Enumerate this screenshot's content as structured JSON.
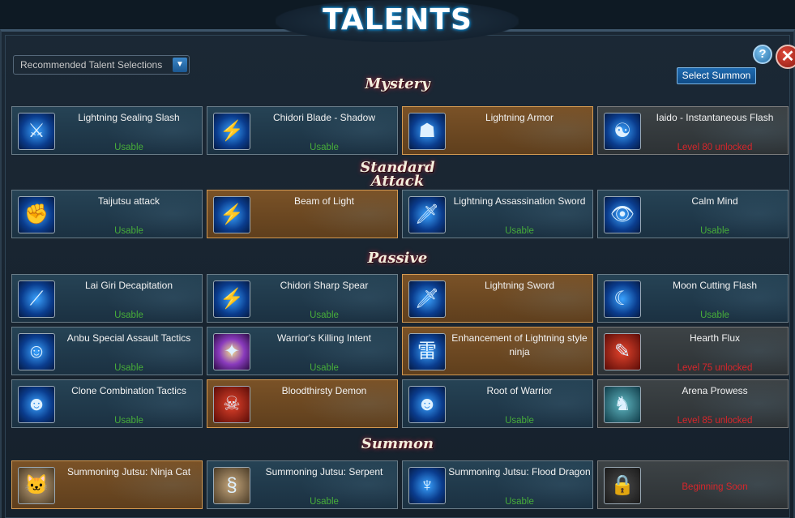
{
  "header": {
    "title": "TALENTS"
  },
  "controls": {
    "dropdown_value": "Recommended Talent Selections",
    "select_summon": "Select Summon",
    "help": "?",
    "close": "✕"
  },
  "sections": [
    {
      "title": "Mystery",
      "cards": [
        {
          "name": "Lightning Sealing Slash",
          "status": "Usable",
          "style": "blue",
          "icon": "blade-icon",
          "status_color": "green"
        },
        {
          "name": "Chidori Blade - Shadow",
          "status": "Usable",
          "style": "blue",
          "icon": "lightning-blade-icon",
          "status_color": "green"
        },
        {
          "name": "Lightning Armor",
          "status": "",
          "style": "gold",
          "icon": "armor-icon",
          "status_color": "green"
        },
        {
          "name": "Iaido - Instantaneous Flash",
          "status": "Level 80 unlocked",
          "style": "grey",
          "icon": "ninja-icon",
          "status_color": "red"
        }
      ]
    },
    {
      "title": "Standard Attack",
      "cards": [
        {
          "name": "Taijutsu attack",
          "status": "Usable",
          "style": "blue",
          "icon": "fist-icon",
          "status_color": "green"
        },
        {
          "name": "Beam of Light",
          "status": "",
          "style": "gold",
          "icon": "beam-icon",
          "status_color": "green"
        },
        {
          "name": "Lightning Assassination Sword",
          "status": "Usable",
          "style": "blue",
          "icon": "sword-icon",
          "status_color": "green"
        },
        {
          "name": "Calm Mind",
          "status": "Usable",
          "style": "blue",
          "icon": "eye-icon",
          "status_color": "green"
        }
      ]
    },
    {
      "title": "Passive",
      "cards": [
        {
          "name": "Lai Giri Decapitation",
          "status": "Usable",
          "style": "blue",
          "icon": "slash-icon",
          "status_color": "green"
        },
        {
          "name": "Chidori Sharp Spear",
          "status": "Usable",
          "style": "blue",
          "icon": "spear-icon",
          "status_color": "green"
        },
        {
          "name": "Lightning Sword",
          "status": "",
          "style": "gold",
          "icon": "sword-icon",
          "status_color": "green"
        },
        {
          "name": "Moon Cutting Flash",
          "status": "Usable",
          "style": "blue",
          "icon": "moon-icon",
          "status_color": "green"
        },
        {
          "name": "Anbu Special Assault Tactics",
          "status": "Usable",
          "style": "blue",
          "icon": "figure-icon",
          "status_color": "green"
        },
        {
          "name": "Warrior's Killing Intent",
          "status": "Usable",
          "style": "blue",
          "icon": "strike-icon",
          "status_color": "green"
        },
        {
          "name": "Enhancement of Lightning style ninja",
          "status": "",
          "style": "gold",
          "icon": "kanji-icon",
          "status_color": "green"
        },
        {
          "name": "Hearth Flux",
          "status": "Level 75 unlocked",
          "style": "grey",
          "icon": "scroll-icon",
          "status_color": "red"
        },
        {
          "name": "Clone Combination Tactics",
          "status": "Usable",
          "style": "blue",
          "icon": "clones-icon",
          "status_color": "green"
        },
        {
          "name": "Bloodthirsty Demon",
          "status": "",
          "style": "gold",
          "icon": "demon-icon",
          "status_color": "green"
        },
        {
          "name": "Root of Warrior",
          "status": "Usable",
          "style": "blue",
          "icon": "head-icon",
          "status_color": "green"
        },
        {
          "name": "Arena Prowess",
          "status": "Level 85 unlocked",
          "style": "grey",
          "icon": "warrior-icon",
          "status_color": "red"
        }
      ]
    },
    {
      "title": "Summon",
      "cards": [
        {
          "name": "Summoning Jutsu: Ninja Cat",
          "status": "",
          "style": "gold",
          "icon": "cat-icon",
          "status_color": "green"
        },
        {
          "name": "Summoning Jutsu: Serpent",
          "status": "Usable",
          "style": "blue",
          "icon": "serpent-icon",
          "status_color": "green"
        },
        {
          "name": "Summoning Jutsu: Flood Dragon",
          "status": "Usable",
          "style": "blue",
          "icon": "dragon-icon",
          "status_color": "green"
        },
        {
          "name": "",
          "status": "Beginning Soon",
          "style": "grey",
          "icon": "lock-icon",
          "status_color": "red"
        }
      ]
    }
  ]
}
